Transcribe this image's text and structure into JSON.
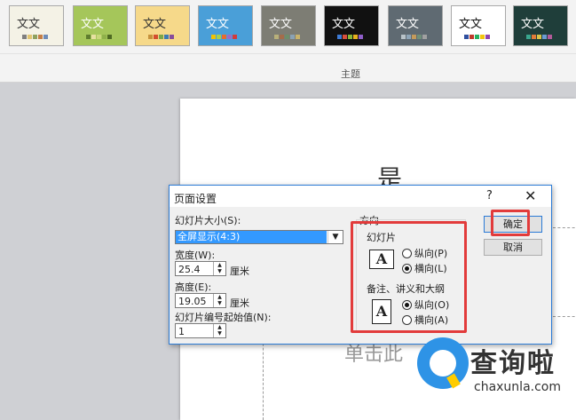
{
  "ribbon": {
    "group_label": "主题",
    "themes": [
      {
        "text": "文文",
        "bg": "#f4f2e6",
        "fg": "#333333",
        "swatches": [
          "#7f7f7f",
          "#e1c572",
          "#8ea15f",
          "#c47f47",
          "#6e8cb8"
        ]
      },
      {
        "text": "文文",
        "bg": "#a5c65a",
        "fg": "#ffffff",
        "swatches": [
          "#5f7d2f",
          "#e7e0a1",
          "#c8d77b",
          "#8fb14a",
          "#4e6a22"
        ]
      },
      {
        "text": "文文",
        "bg": "#f6d98a",
        "fg": "#333333",
        "swatches": [
          "#c6923c",
          "#d44f2f",
          "#7da64a",
          "#3d7bb2",
          "#874c9c"
        ]
      },
      {
        "text": "文文",
        "bg": "#4a9fd8",
        "fg": "#ffffff",
        "swatches": [
          "#f2c200",
          "#a8d04b",
          "#e86b2f",
          "#9c6bc8",
          "#d13b3b"
        ]
      },
      {
        "text": "文文",
        "bg": "#7d7d74",
        "fg": "#ffffff",
        "swatches": [
          "#b8b07a",
          "#a56c4a",
          "#6d8d6a",
          "#8aa2b5",
          "#c9b36b"
        ]
      },
      {
        "text": "文文",
        "bg": "#111111",
        "fg": "#ffffff",
        "swatches": [
          "#3d7bd6",
          "#d64f3d",
          "#86b838",
          "#e6b11e",
          "#8f5ec9"
        ]
      },
      {
        "text": "文文",
        "bg": "#5f6a72",
        "fg": "#ffffff",
        "swatches": [
          "#b9c3c9",
          "#8ea5b8",
          "#c49a5b",
          "#6f8f79",
          "#a0a0a0"
        ]
      },
      {
        "text": "文文",
        "bg": "#ffffff",
        "fg": "#111111",
        "swatches": [
          "#2f4f9f",
          "#c0392b",
          "#27ae60",
          "#f1c40f",
          "#8e44ad"
        ]
      },
      {
        "text": "文文",
        "bg": "#1f3e3a",
        "fg": "#ffffff",
        "swatches": [
          "#3aa58d",
          "#e07b39",
          "#d9c248",
          "#6b9bd1",
          "#b35a9a"
        ]
      }
    ]
  },
  "slide": {
    "title_fragment": "是",
    "subtitle": "单击此"
  },
  "dialog": {
    "title": "页面设置",
    "help": "?",
    "close": "✕",
    "size_label": "幻灯片大小(S):",
    "size_value": "全屏显示(4:3)",
    "width_label": "宽度(W):",
    "width_value": "25.4",
    "width_unit": "厘米",
    "height_label": "高度(E):",
    "height_value": "19.05",
    "height_unit": "厘米",
    "number_label": "幻灯片编号起始值(N):",
    "number_value": "1",
    "orientation_label": "方向",
    "slides_label": "幻灯片",
    "slides_portrait": "纵向(P)",
    "slides_landscape": "横向(L)",
    "notes_label": "备注、讲义和大纲",
    "notes_portrait": "纵向(O)",
    "notes_landscape": "横向(A)",
    "ok": "确定",
    "cancel": "取消",
    "glyph": "A"
  },
  "watermark": {
    "name": "查询啦",
    "url": "chaxunla.com"
  },
  "colors": {
    "accent": "#2b7bd6",
    "highlight_red": "#e23b3b",
    "selection": "#3399ff"
  }
}
